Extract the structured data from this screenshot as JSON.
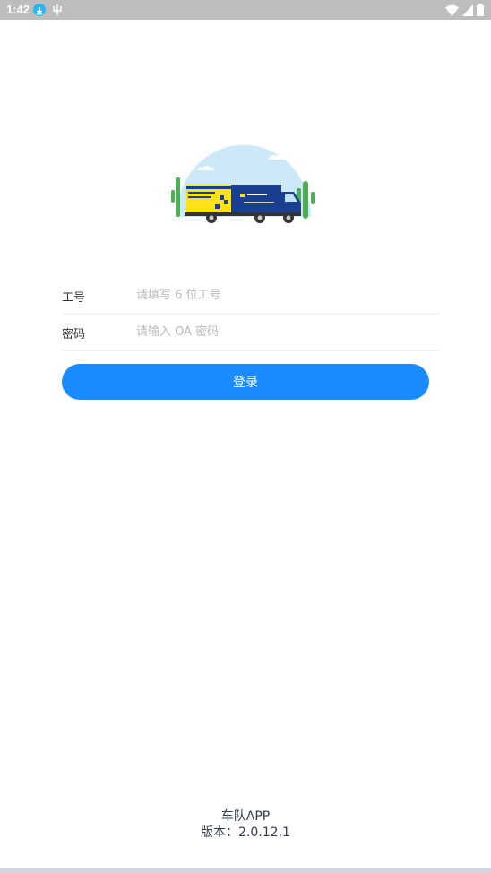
{
  "status_bar": {
    "time": "1:42",
    "icons": [
      "download-icon",
      "usb-icon",
      "wifi-icon",
      "signal-icon",
      "battery-icon"
    ]
  },
  "login": {
    "employee_id_label": "工号",
    "employee_id_placeholder": "请填写 6 位工号",
    "employee_id_value": "",
    "password_label": "密码",
    "password_placeholder": "请输入 OA 密码",
    "password_value": "",
    "submit_label": "登录"
  },
  "footer": {
    "app_name": "车队APP",
    "version": "版本：2.0.12.1"
  },
  "colors": {
    "accent": "#1a8cff",
    "status_bar": "#bdbdbd",
    "label_text": "#333333",
    "placeholder": "#b8b8b8"
  }
}
